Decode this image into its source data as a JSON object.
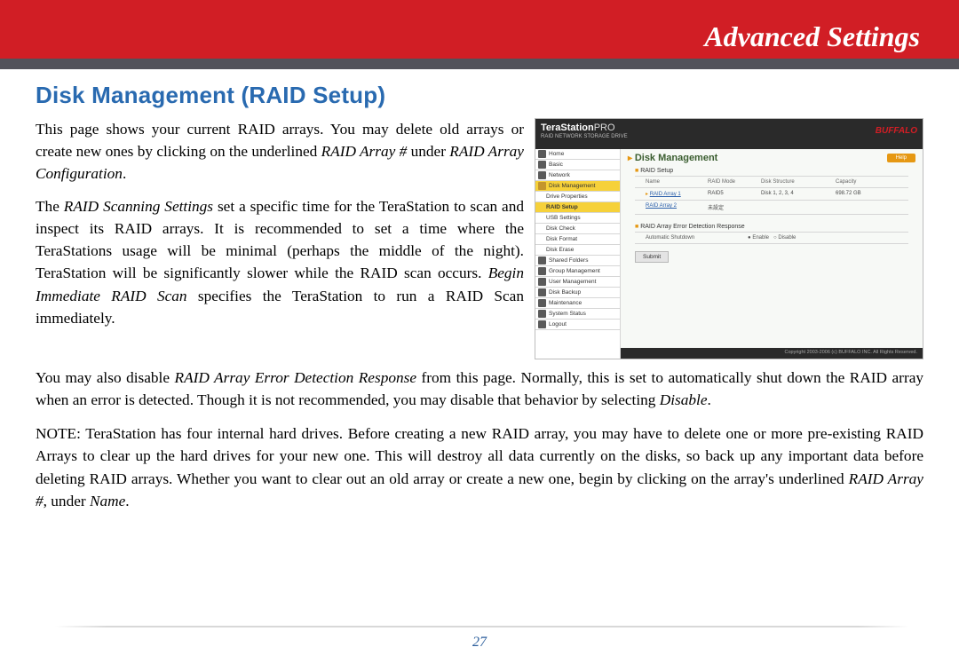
{
  "banner": {
    "title": "Advanced Settings"
  },
  "section_title": "Disk Management (RAID Setup)",
  "page_number": "27",
  "body": {
    "p1a": "This page shows your current RAID arrays.  You may delete old arrays or create new ones by clicking on the underlined ",
    "p1i": "RAID Array #",
    "p1b": " under ",
    "p1i2": "RAID Array Configuration",
    "p1c": ".",
    "p2a": "The ",
    "p2i": "RAID Scanning Settings",
    "p2b": " set a specific time for the TeraStation to scan and inspect its RAID arrays.  It is recommended to set a time where the TeraStations usage will be minimal (perhaps the middle of the night).  TeraStation will be significantly slower while the RAID scan occurs. ",
    "p2i2": "Begin Immediate RAID Scan",
    "p2c": " specifies the TeraStation to run a RAID Scan immediately.",
    "p3a": "You may also disable ",
    "p3i": "RAID Array Error Detection Response",
    "p3b": " from this page.  Normally, this is set to automatically shut down the RAID array when an error is detected.  Though it is not recommended, you may disable that behavior by selecting ",
    "p3i2": "Disable",
    "p3c": ".",
    "p4a": "NOTE: TeraStation has four internal hard drives.  Before creating a new RAID array, you may have to delete one or more pre-existing RAID Arrays to clear up the hard drives for your new one.  This will destroy all data currently on the disks, so back up any important data before deleting RAID arrays.  Whether you want to clear out an old array or create a new one, begin by clicking on the array's underlined ",
    "p4i": "RAID Array #",
    "p4b": ", under ",
    "p4i2": "Name",
    "p4c": "."
  },
  "screenshot": {
    "product": "TeraStation",
    "product_suffix": "PRO",
    "product_sub": "RAID NETWORK STORAGE DRIVE",
    "brand": "BUFFALO",
    "nav": [
      "Home",
      "Basic",
      "Network",
      "Disk Management",
      "Drive Properties",
      "RAID Setup",
      "USB Settings",
      "Disk Check",
      "Disk Format",
      "Disk Erase",
      "Shared Folders",
      "Group Management",
      "User Management",
      "Disk Backup",
      "Maintenance",
      "System Status",
      "Logout"
    ],
    "main_title": "Disk Management",
    "help_label": "Help",
    "sect1": "RAID Setup",
    "th": {
      "name": "Name",
      "mode": "RAID Mode",
      "struct": "Disk Structure",
      "cap": "Capacity"
    },
    "row1": {
      "name": "RAID Array 1",
      "mode": "RAID5",
      "struct": "Disk 1, 2, 3, 4",
      "cap": "698.72 GB"
    },
    "row2": {
      "name": "RAID Array 2",
      "mode": "未設定",
      "struct": "",
      "cap": ""
    },
    "sect2": "RAID Array Error Detection Response",
    "opt_label": "Automatic Shutdown",
    "opt_a": "Enable",
    "opt_b": "Disable",
    "submit": "Submit",
    "footer": "Copyright 2003-2006 (c) BUFFALO INC. All Rights Reserved."
  }
}
